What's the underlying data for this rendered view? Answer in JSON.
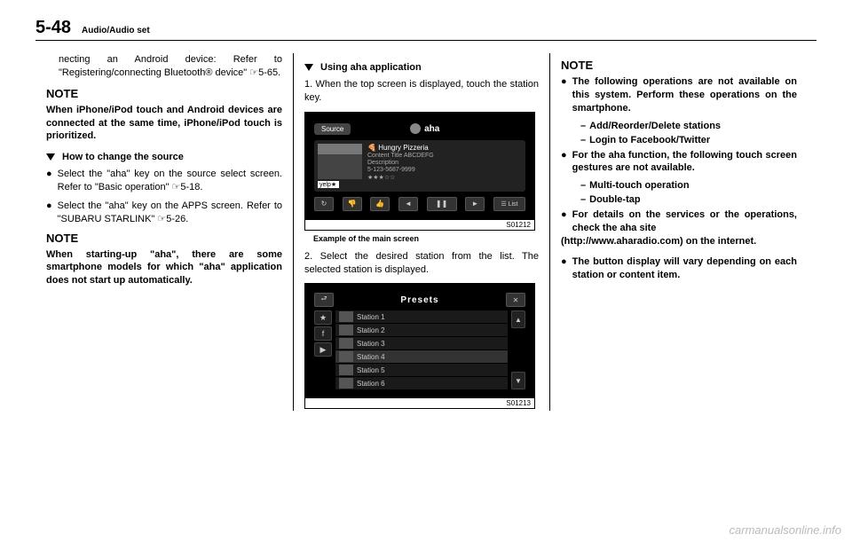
{
  "header": {
    "page": "5-48",
    "section": "Audio/Audio set"
  },
  "col1": {
    "p1": "necting an Android device: Refer to \"Registering/connecting Bluetooth® device\" ☞5-65.",
    "note1_h": "NOTE",
    "note1_p": "When iPhone/iPod touch and Android devices are connected at the same time, iPhone/iPod touch is prioritized.",
    "sub1": "How to change the source",
    "b1": "Select the \"aha\" key on the source select screen. Refer to \"Basic operation\" ☞5-18.",
    "b2": "Select the \"aha\" key on the APPS screen. Refer to \"SUBARU STARLINK\" ☞5-26.",
    "note2_h": "NOTE",
    "note2_p": "When starting-up \"aha\", there are some smartphone models for which \"aha\" application does not start up automatically."
  },
  "col2": {
    "sub1": "Using aha application",
    "step1": "1. When the top screen is displayed, touch the station key.",
    "fig1": {
      "source": "Source",
      "logo": "aha",
      "title": "Hungry Pizzeria",
      "line1": "Content Title ABCDEFG",
      "line2": "Description",
      "line3": "5-123-5687-9999",
      "yelp": "yelp★",
      "list": "☰ List",
      "id": "S01212"
    },
    "caption1": "Example of the main screen",
    "step2": "2. Select the desired station from the list. The selected station is displayed.",
    "fig2": {
      "presets": "Presets",
      "s1": "Station 1",
      "s2": "Station 2",
      "s3": "Station 3",
      "s4": "Station 4",
      "s5": "Station 5",
      "s6": "Station 6",
      "id": "S01213"
    }
  },
  "col3": {
    "note_h": "NOTE",
    "b1": "The following operations are not available on this system. Perform these operations on the smartphone.",
    "d1": "Add/Reorder/Delete stations",
    "d2": "Login to Facebook/Twitter",
    "b2": "For the aha function, the following touch screen gestures are not available.",
    "d3": "Multi-touch operation",
    "d4": "Double-tap",
    "b3": "For details on the services or the operations, check the aha site",
    "b3b": "(http://www.aharadio.com) on the internet.",
    "b4": "The button display will vary depending on each station or content item."
  },
  "watermark": "carmanualsonline.info"
}
